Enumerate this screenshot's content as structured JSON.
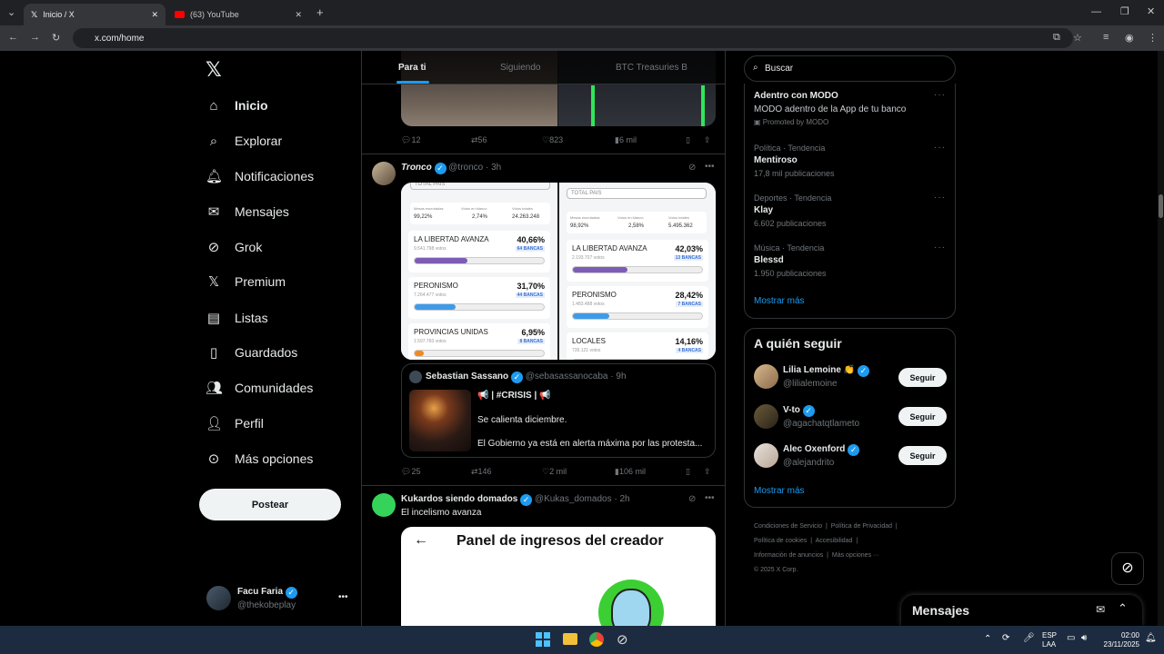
{
  "browser": {
    "tabs": [
      {
        "label": "Inicio / X"
      },
      {
        "label": "(63) YouTube"
      }
    ],
    "url": "x.com/home"
  },
  "nav": {
    "items": [
      {
        "label": "Inicio",
        "icon": "home-icon"
      },
      {
        "label": "Explorar",
        "icon": "search-icon"
      },
      {
        "label": "Notificaciones",
        "icon": "bell-icon"
      },
      {
        "label": "Mensajes",
        "icon": "mail-icon"
      },
      {
        "label": "Grok",
        "icon": "grok-icon"
      },
      {
        "label": "Premium",
        "icon": "x-logo-icon"
      },
      {
        "label": "Listas",
        "icon": "list-icon"
      },
      {
        "label": "Guardados",
        "icon": "bookmark-icon"
      },
      {
        "label": "Comunidades",
        "icon": "people-icon"
      },
      {
        "label": "Perfil",
        "icon": "person-icon"
      },
      {
        "label": "Más opciones",
        "icon": "more-circle-icon"
      }
    ],
    "post_label": "Postear",
    "account": {
      "name": "Facu Faria",
      "handle": "@thekobeplay"
    }
  },
  "feed": {
    "tabs": [
      "Para ti",
      "Siguiendo",
      "BTC Treasuries B"
    ],
    "post1_actions": {
      "replies": "12",
      "reposts": "56",
      "likes": "823",
      "views": "6 mil"
    },
    "post2": {
      "author": "Tronco",
      "handle": "@tronco",
      "time": "· 3h",
      "left_panel": {
        "select": "TOTAL PAIS",
        "stats_labels": [
          "Mesas escrutadas",
          "Votos en blanco",
          "Votos totales"
        ],
        "stats_values": [
          "99,22%",
          "2,74%",
          "24.263.248"
        ],
        "rows": [
          {
            "name": "LA LIBERTAD AVANZA",
            "pct": "40,66%",
            "votes": "9.541.798 votos",
            "bancas": "64 BANCAS",
            "fill": 0.4066,
            "color": "#7d5cb6"
          },
          {
            "name": "PERONISMO",
            "pct": "31,70%",
            "votes": "7.264.477 votos",
            "bancas": "44 BANCAS",
            "fill": 0.317,
            "color": "#3d9be9"
          },
          {
            "name": "PROVINCIAS UNIDAS",
            "pct": "6,95%",
            "votes": "1.597.760 votos",
            "bancas": "8 BANCAS",
            "fill": 0.0695,
            "color": "#f08a24"
          }
        ]
      },
      "right_panel": {
        "select": "TOTAL PAIS",
        "stats_labels": [
          "Mesas escrutadas",
          "Votos en blanco",
          "Votos totales"
        ],
        "stats_values": [
          "98,92%",
          "2,58%",
          "5.495.362"
        ],
        "rows": [
          {
            "name": "LA LIBERTAD AVANZA",
            "pct": "42,03%",
            "votes": "2.193.707 votos",
            "bancas": "13 BANCAS",
            "fill": 0.4203,
            "color": "#7d5cb6"
          },
          {
            "name": "PERONISMO",
            "pct": "28,42%",
            "votes": "1.483.488 votos",
            "bancas": "7 BANCAS",
            "fill": 0.2842,
            "color": "#3d9be9"
          },
          {
            "name": "LOCALES",
            "pct": "14,16%",
            "votes": "739.121 votos",
            "bancas": "4 BANCAS",
            "fill": 0.1416,
            "color": "#f08a24"
          }
        ]
      },
      "quote": {
        "author": "Sebastian Sassano",
        "handle": "@sebasassanocaba",
        "time": "· 9h",
        "line1": "📢 | #CRISIS | 📢",
        "line2": "Se calienta diciembre.",
        "line3": "El Gobierno ya está en alerta máxima por las protesta..."
      },
      "actions": {
        "replies": "25",
        "reposts": "146",
        "likes": "2 mil",
        "views": "106 mil"
      }
    },
    "post3": {
      "author": "Kukardos siendo domados",
      "handle": "@Kukas_domados",
      "time": "· 2h",
      "text": "El incelismo avanza",
      "card_title": "Panel de ingresos del creador"
    }
  },
  "sidebar": {
    "search_placeholder": "Buscar",
    "promo": {
      "title": "Adentro con MODO",
      "subtitle": "MODO adentro de la App de tu banco",
      "promoted": "Promoted by MODO"
    },
    "trends": [
      {
        "category": "Política · Tendencia",
        "name": "Mentiroso",
        "count": "17,8 mil publicaciones"
      },
      {
        "category": "Deportes · Tendencia",
        "name": "Klay",
        "count": "6.602 publicaciones"
      },
      {
        "category": "Música · Tendencia",
        "name": "Blessd",
        "count": "1.950 publicaciones"
      }
    ],
    "show_more": "Mostrar más",
    "follow_title": "A quién seguir",
    "follow": [
      {
        "name": "Lilia Lemoine 👏",
        "handle": "@lilialemoine"
      },
      {
        "name": "V-to",
        "handle": "@agachatqtlameto"
      },
      {
        "name": "Alec Oxenford",
        "handle": "@alejandrito"
      }
    ],
    "follow_button": "Seguir",
    "follow_more": "Mostrar más",
    "footer": [
      "Condiciones de Servicio",
      "Política de Privacidad",
      "Política de cookies",
      "Accesibilidad",
      "Información de anuncios",
      "Más opciones ···",
      "© 2025 X Corp."
    ]
  },
  "messages_drawer": {
    "title": "Mensajes"
  },
  "taskbar": {
    "lang1": "ESP",
    "lang2": "LAA",
    "time": "02:00",
    "date": "23/11/2025"
  }
}
